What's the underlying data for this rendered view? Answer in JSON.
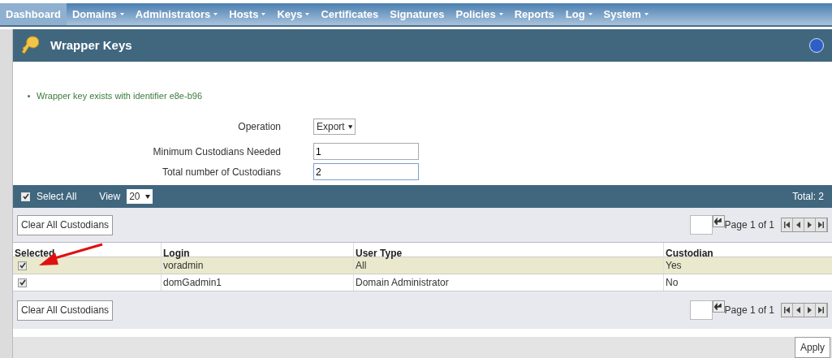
{
  "nav": [
    {
      "label": "Dashboard",
      "selected": true,
      "has_menu": false
    },
    {
      "label": "Domains",
      "selected": false,
      "has_menu": true
    },
    {
      "label": "Administrators",
      "selected": false,
      "has_menu": true
    },
    {
      "label": "Hosts",
      "selected": false,
      "has_menu": true
    },
    {
      "label": "Keys",
      "selected": false,
      "has_menu": true
    },
    {
      "label": "Certificates",
      "selected": false,
      "has_menu": false
    },
    {
      "label": "Signatures",
      "selected": false,
      "has_menu": false
    },
    {
      "label": "Policies",
      "selected": false,
      "has_menu": true
    },
    {
      "label": "Reports",
      "selected": false,
      "has_menu": false
    },
    {
      "label": "Log",
      "selected": false,
      "has_menu": true
    },
    {
      "label": "System",
      "selected": false,
      "has_menu": true
    }
  ],
  "panel": {
    "title": "Wrapper Keys"
  },
  "message": "Wrapper key exists with identifier e8e-b96",
  "form": {
    "operation": {
      "label": "Operation",
      "value": "Export"
    },
    "min_custodians": {
      "label": "Minimum Custodians Needed",
      "value": "1"
    },
    "total_custodians": {
      "label": "Total number of Custodians",
      "value": "2"
    }
  },
  "toolbar": {
    "select_all": {
      "label": "Select All",
      "checked": true
    },
    "view_label": "View",
    "view_value": "20",
    "total": "Total: 2"
  },
  "clear_button": "Clear All Custodians",
  "pager": {
    "page_text": "Page 1 of 1"
  },
  "table": {
    "columns": [
      "Selected",
      "Login",
      "User Type",
      "Custodian"
    ],
    "rows": [
      {
        "checked": true,
        "highlighted": true,
        "login": "voradmin",
        "user_type": "All",
        "custodian": "Yes"
      },
      {
        "checked": true,
        "highlighted": false,
        "login": "domGadmin1",
        "user_type": "Domain Administrator",
        "custodian": "No"
      }
    ]
  },
  "bottom_clear_button": "Clear All Custodians",
  "bottom_pager": {
    "page_text": "Page 1 of 1"
  },
  "apply_button": "Apply"
}
